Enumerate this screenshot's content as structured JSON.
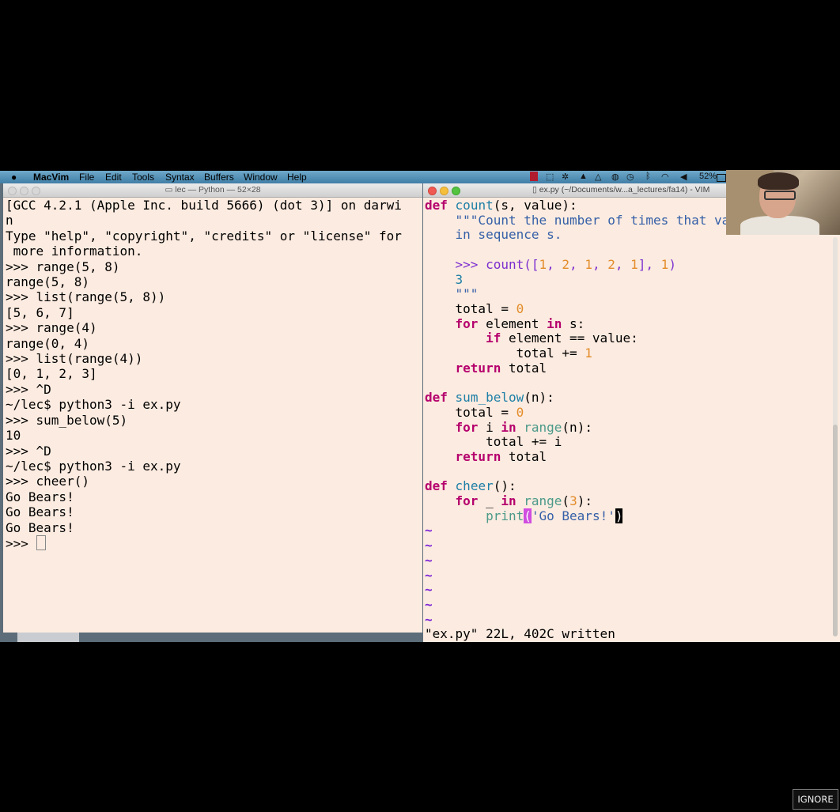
{
  "menubar": {
    "app_name": "MacVim",
    "items": [
      "File",
      "Edit",
      "Tools",
      "Syntax",
      "Buffers",
      "Window",
      "Help"
    ],
    "battery": "52%"
  },
  "terminal": {
    "title": "lec — Python — 52×28",
    "lines": [
      "[GCC 4.2.1 (Apple Inc. build 5666) (dot 3)] on darwi",
      "n",
      "Type \"help\", \"copyright\", \"credits\" or \"license\" for",
      " more information.",
      ">>> range(5, 8)",
      "range(5, 8)",
      ">>> list(range(5, 8))",
      "[5, 6, 7]",
      ">>> range(4)",
      "range(0, 4)",
      ">>> list(range(4))",
      "[0, 1, 2, 3]",
      ">>> ^D",
      "~/lec$ python3 -i ex.py",
      ">>> sum_below(5)",
      "10",
      ">>> ^D",
      "~/lec$ python3 -i ex.py",
      ">>> cheer()",
      "Go Bears!",
      "Go Bears!",
      "Go Bears!"
    ],
    "prompt": ">>> "
  },
  "vim": {
    "title": "ex.py (~/Documents/w...a_lectures/fa14) - VIM",
    "status": "\"ex.py\" 22L, 402C written",
    "tilde": "~",
    "code": {
      "def": "def",
      "for": "for",
      "in": "in",
      "if": "if",
      "return": "return",
      "count": "count",
      "count_sig": "(s, value):",
      "doc1": "\"\"\"Count the number of times that val",
      "doc2": "in sequence s.",
      "doctest_prompt": ">>> ",
      "doctest_call": "count",
      "doctest_paren": "([",
      "n1": "1",
      "n2": "2",
      "n3": "1",
      "n4": "2",
      "n5": "1",
      "sep": ", ",
      "doctest_close": "], ",
      "doctest_arg": "1",
      "doctest_end": ")",
      "doctest_result": "3",
      "doc_end": "\"\"\"",
      "total_assign": "total = ",
      "zero": "0",
      "element_s": " element ",
      "s_colon": " s:",
      "if_cond": " element == value:",
      "total_inc": "total += ",
      "one": "1",
      "total": " total",
      "sum_below": "sum_below",
      "sum_sig": "(n):",
      "i": " i ",
      "range": "range",
      "range_n": "(n):",
      "total_inc_i": "total += i",
      "cheer": "cheer",
      "cheer_sig": "():",
      "underscore": " _ ",
      "range_open": "(",
      "three": "3",
      "range_close": "):",
      "print": "print",
      "paren_open": "(",
      "go_bears": "'Go Bears!'",
      "paren_close": ")"
    }
  },
  "ignore_label": "IGNORE"
}
